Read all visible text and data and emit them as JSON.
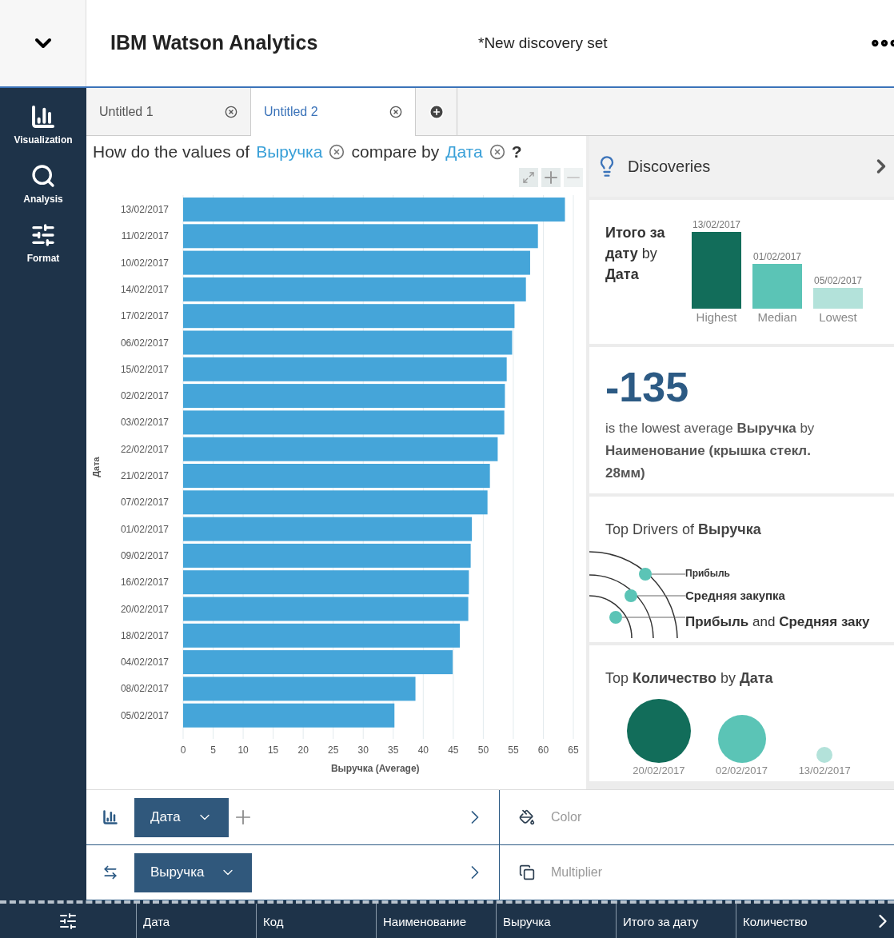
{
  "header": {
    "app_title": "IBM Watson Analytics",
    "doc_title": "*New discovery set"
  },
  "sidebar": {
    "items": [
      {
        "kind": "visualization",
        "label": "Visualization"
      },
      {
        "kind": "analysis",
        "label": "Analysis"
      },
      {
        "kind": "format",
        "label": "Format"
      }
    ]
  },
  "tabs": [
    {
      "label": "Untitled 1",
      "selected": false
    },
    {
      "label": "Untitled 2",
      "selected": true
    }
  ],
  "question": {
    "prefix": "How do the values of",
    "measure": "Выручка",
    "middle": "compare by",
    "dimension": "Дата",
    "help": "?"
  },
  "chart_data": {
    "type": "bar",
    "orientation": "horizontal",
    "xlabel": "Выручка (Average)",
    "ylabel": "Дата",
    "categories": [
      "13/02/2017",
      "11/02/2017",
      "10/02/2017",
      "14/02/2017",
      "17/02/2017",
      "06/02/2017",
      "15/02/2017",
      "02/02/2017",
      "03/02/2017",
      "22/02/2017",
      "21/02/2017",
      "07/02/2017",
      "01/02/2017",
      "09/02/2017",
      "16/02/2017",
      "20/02/2017",
      "18/02/2017",
      "04/02/2017",
      "08/02/2017",
      "05/02/2017"
    ],
    "series": [
      {
        "color": "#45a5d9",
        "values": [
          63.6,
          59.1,
          57.8,
          57.1,
          55.2,
          54.8,
          53.9,
          53.6,
          53.5,
          52.4,
          51.1,
          50.7,
          48.1,
          47.9,
          47.6,
          47.5,
          46.1,
          44.9,
          38.7,
          35.2
        ]
      }
    ],
    "grid": true,
    "xlim": [
      0,
      65
    ],
    "xticks": [
      0,
      5,
      10,
      15,
      20,
      25,
      30,
      35,
      40,
      45,
      50,
      55,
      60,
      65
    ]
  },
  "discoveries": {
    "title": "Discoveries",
    "cards": [
      {
        "kind": "bars",
        "title": "**Итого за** **дату** by **Дата**",
        "items": [
          {
            "label": "13/02/2017",
            "caption": "Highest",
            "color": "#126d5a"
          },
          {
            "label": "01/02/2017",
            "caption": "Median",
            "color": "#5bc4b6"
          },
          {
            "label": "05/02/2017",
            "caption": "Lowest",
            "color": "#b3e2da"
          }
        ]
      },
      {
        "kind": "stat",
        "value": "-135",
        "text": "is the lowest average **Выручка** by **Наименование** **(крышка стекл. 28мм)**"
      },
      {
        "kind": "drivers",
        "title": "Top Drivers of **Выручка**",
        "items": [
          {
            "label": "**Прибыль**"
          },
          {
            "label": "**Средняя закупка**"
          },
          {
            "label": "**Прибыль** and **Средняя заку**"
          }
        ]
      },
      {
        "kind": "bubbles",
        "title": "Top **Количество** by **Дата**",
        "items": [
          {
            "label": "20/02/2017",
            "color": "#126d5a"
          },
          {
            "label": "02/02/2017",
            "color": "#5bc4b6"
          },
          {
            "label": "13/02/2017",
            "color": "#b3e2da"
          }
        ]
      }
    ]
  },
  "shelves": [
    {
      "kind": "axis_y",
      "field": "Дата",
      "can_add": true,
      "target": "Color"
    },
    {
      "kind": "axis_x",
      "field": "Выручка",
      "can_add": false,
      "target": "Multiplier"
    }
  ],
  "data_columns": [
    "Дата",
    "Код",
    "Наименование",
    "Выручка",
    "Итого за дату",
    "Количество"
  ]
}
